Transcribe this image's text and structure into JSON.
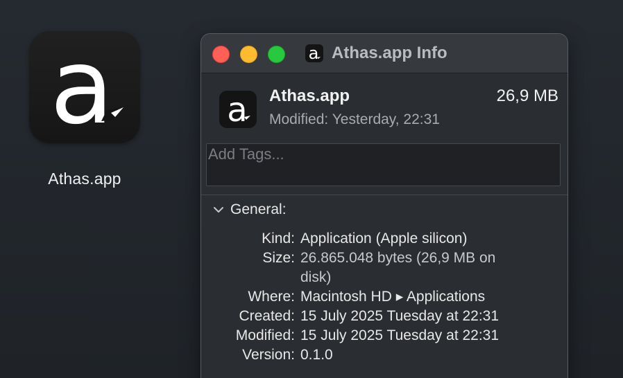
{
  "desktop": {
    "icon_label": "Athas.app"
  },
  "window": {
    "title": "Athas.app Info",
    "traffic_lights": {
      "close": "#ff5f57",
      "minimize": "#febc2e",
      "zoom": "#28c840"
    }
  },
  "header": {
    "file_name": "Athas.app",
    "file_size": "26,9 MB",
    "modified_label": "Modified:",
    "modified_value": "Yesterday, 22:31"
  },
  "tags": {
    "placeholder": "Add Tags..."
  },
  "general": {
    "title": "General:",
    "rows": [
      {
        "key": "Kind:",
        "value": "Application (Apple silicon)"
      },
      {
        "key": "Size:",
        "value": "26.865.048 bytes (26,9 MB on disk)"
      },
      {
        "key": "Where:",
        "value": "Macintosh HD ▸ Applications"
      },
      {
        "key": "Created:",
        "value": "15 July 2025 Tuesday at 22:31"
      },
      {
        "key": "Modified:",
        "value": "15 July 2025 Tuesday at 22:31"
      },
      {
        "key": "Version:",
        "value": "0.1.0"
      }
    ]
  },
  "icons": {
    "app": "athas-app-icon",
    "chevron": "chevron-down-icon"
  },
  "colors": {
    "window_bg": "#2a2d31",
    "titlebar_bg": "#36393e",
    "desktop_bg": "#20242a"
  }
}
